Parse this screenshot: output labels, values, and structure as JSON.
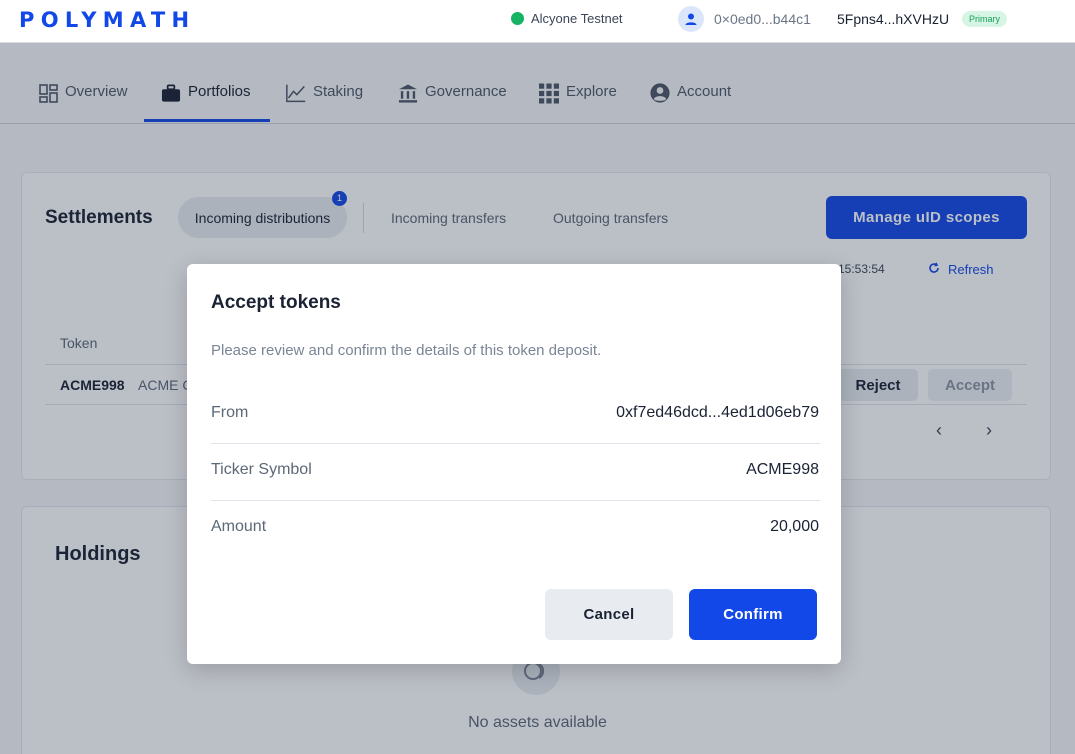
{
  "header": {
    "logo": "POLYMATH",
    "network": "Alcyone Testnet",
    "address": "0×0ed0...b44c1",
    "identity": "5Fpns4...hXVHzU",
    "identity_badge": "Primary"
  },
  "nav": {
    "items": [
      {
        "label": "Overview",
        "icon": "grid-icon"
      },
      {
        "label": "Portfolios",
        "icon": "briefcase-icon",
        "active": true
      },
      {
        "label": "Staking",
        "icon": "chart-line-icon"
      },
      {
        "label": "Governance",
        "icon": "bank-icon"
      },
      {
        "label": "Explore",
        "icon": "apps-icon"
      },
      {
        "label": "Account",
        "icon": "user-circle-icon"
      }
    ]
  },
  "settlements": {
    "title": "Settlements",
    "tabs": {
      "incoming_distributions": "Incoming distributions",
      "incoming_distributions_count": "1",
      "incoming_transfers": "Incoming transfers",
      "outgoing_transfers": "Outgoing transfers"
    },
    "manage_button": "Manage uID scopes",
    "updated_time": "15:53:54",
    "refresh_label": "Refresh",
    "column_token": "Token",
    "row": {
      "symbol": "ACME998",
      "name": "ACME C",
      "reject": "Reject",
      "accept": "Accept"
    },
    "pager_prev": "‹",
    "pager_next": "›"
  },
  "holdings": {
    "title": "Holdings",
    "empty_text": "No assets available"
  },
  "modal": {
    "title": "Accept tokens",
    "subtitle": "Please review and confirm the details of this token deposit.",
    "from_label": "From",
    "from_value": "0xf7ed46dcd...4ed1d06eb79",
    "ticker_label": "Ticker Symbol",
    "ticker_value": "ACME998",
    "amount_label": "Amount",
    "amount_value": "20,000",
    "cancel": "Cancel",
    "confirm": "Confirm"
  },
  "colors": {
    "brand": "#1348e8",
    "online": "#16b364"
  }
}
